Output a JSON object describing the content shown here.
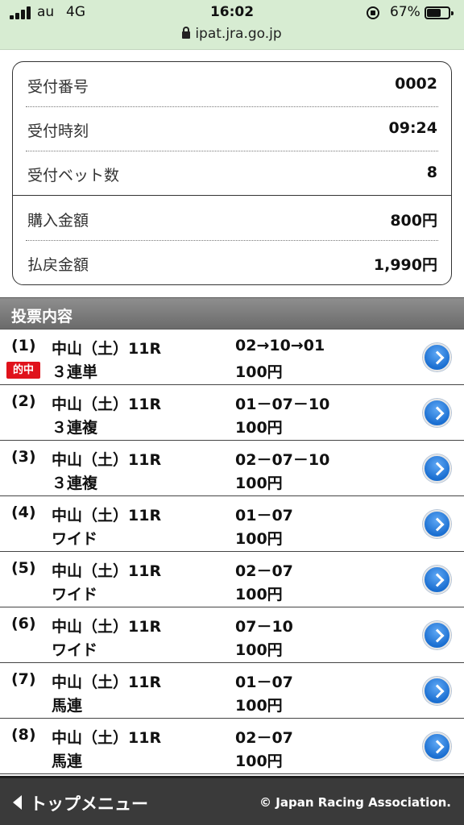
{
  "status_bar": {
    "carrier": "au",
    "network": "4G",
    "time": "16:02",
    "battery_percent": "67%",
    "battery_level": 0.67
  },
  "url_bar": {
    "domain": "ipat.jra.go.jp"
  },
  "summary": {
    "rows": [
      {
        "label": "受付番号",
        "value": "0002"
      },
      {
        "label": "受付時刻",
        "value": "09:24"
      },
      {
        "label": "受付ベット数",
        "value": "8"
      },
      {
        "label": "購入金額",
        "value": "800円"
      },
      {
        "label": "払戻金額",
        "value": "1,990円"
      }
    ]
  },
  "section": {
    "title": "投票内容"
  },
  "bets": [
    {
      "index": "(1)",
      "venue": "中山（土）11R",
      "type": "３連単",
      "combo": "02→10→01",
      "amount": "100円",
      "hit_badge": "的中"
    },
    {
      "index": "(2)",
      "venue": "中山（土）11R",
      "type": "３連複",
      "combo": "01－07－10",
      "amount": "100円"
    },
    {
      "index": "(3)",
      "venue": "中山（土）11R",
      "type": "３連複",
      "combo": "02－07－10",
      "amount": "100円"
    },
    {
      "index": "(4)",
      "venue": "中山（土）11R",
      "type": "ワイド",
      "combo": "01－07",
      "amount": "100円"
    },
    {
      "index": "(5)",
      "venue": "中山（土）11R",
      "type": "ワイド",
      "combo": "02－07",
      "amount": "100円"
    },
    {
      "index": "(6)",
      "venue": "中山（土）11R",
      "type": "ワイド",
      "combo": "07－10",
      "amount": "100円"
    },
    {
      "index": "(7)",
      "venue": "中山（土）11R",
      "type": "馬連",
      "combo": "01－07",
      "amount": "100円"
    },
    {
      "index": "(8)",
      "venue": "中山（土）11R",
      "type": "馬連",
      "combo": "02－07",
      "amount": "100円"
    }
  ],
  "footer": {
    "menu_label": "トップメニュー",
    "copyright": "© Japan Racing Association."
  },
  "colors": {
    "hit_badge": "#e0121b",
    "header_gray": "#7a7a7a",
    "footer_bg": "#3a3a3a",
    "chrome_green": "#d7ecd2",
    "detail_button": "#1b6fd1"
  }
}
